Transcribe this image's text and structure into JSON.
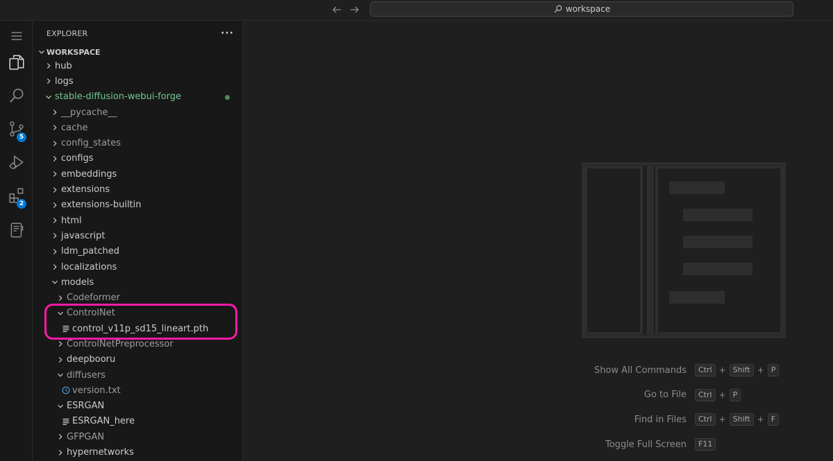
{
  "titlebar": {
    "back_label": "←",
    "forward_label": "→",
    "command_center": "workspace",
    "icons": {
      "back": "arrow-left-icon",
      "forward": "arrow-right-icon",
      "search": "search-icon"
    }
  },
  "activity_bar": {
    "items": [
      {
        "name": "menu",
        "icon": "hamburger-menu-icon"
      },
      {
        "name": "explorer",
        "icon": "files-icon",
        "active": true
      },
      {
        "name": "search",
        "icon": "search-icon"
      },
      {
        "name": "source-control",
        "icon": "source-control-icon",
        "badge": "5"
      },
      {
        "name": "run-debug",
        "icon": "run-debug-icon"
      },
      {
        "name": "extensions",
        "icon": "extensions-icon",
        "badge": "2"
      },
      {
        "name": "notebook",
        "icon": "notebook-icon"
      }
    ]
  },
  "sidebar": {
    "title": "EXPLORER",
    "more_label": "···",
    "workspace_label": "WORKSPACE",
    "tree": [
      {
        "label": "hub",
        "depth": 0,
        "type": "folder",
        "expanded": false
      },
      {
        "label": "logs",
        "depth": 0,
        "type": "folder",
        "expanded": false
      },
      {
        "label": "stable-diffusion-webui-forge",
        "depth": 0,
        "type": "folder",
        "expanded": true,
        "git": true
      },
      {
        "label": "__pycache__",
        "depth": 1,
        "type": "folder",
        "expanded": false,
        "dim": true
      },
      {
        "label": "cache",
        "depth": 1,
        "type": "folder",
        "expanded": false,
        "dim": true
      },
      {
        "label": "config_states",
        "depth": 1,
        "type": "folder",
        "expanded": false,
        "dim": true
      },
      {
        "label": "configs",
        "depth": 1,
        "type": "folder",
        "expanded": false
      },
      {
        "label": "embeddings",
        "depth": 1,
        "type": "folder",
        "expanded": false
      },
      {
        "label": "extensions",
        "depth": 1,
        "type": "folder",
        "expanded": false
      },
      {
        "label": "extensions-builtin",
        "depth": 1,
        "type": "folder",
        "expanded": false
      },
      {
        "label": "html",
        "depth": 1,
        "type": "folder",
        "expanded": false
      },
      {
        "label": "javascript",
        "depth": 1,
        "type": "folder",
        "expanded": false
      },
      {
        "label": "ldm_patched",
        "depth": 1,
        "type": "folder",
        "expanded": false
      },
      {
        "label": "localizations",
        "depth": 1,
        "type": "folder",
        "expanded": false
      },
      {
        "label": "models",
        "depth": 1,
        "type": "folder",
        "expanded": true
      },
      {
        "label": "Codeformer",
        "depth": 2,
        "type": "folder",
        "expanded": false,
        "dim": true
      },
      {
        "label": "ControlNet",
        "depth": 2,
        "type": "folder",
        "expanded": true,
        "dim": true
      },
      {
        "label": "control_v11p_sd15_lineart.pth",
        "depth": 3,
        "type": "file",
        "icon": "lines-file-icon"
      },
      {
        "label": "ControlNetPreprocessor",
        "depth": 2,
        "type": "folder",
        "expanded": false,
        "dim": true
      },
      {
        "label": "deepbooru",
        "depth": 2,
        "type": "folder",
        "expanded": false
      },
      {
        "label": "diffusers",
        "depth": 2,
        "type": "folder",
        "expanded": true,
        "dim": true
      },
      {
        "label": "version.txt",
        "depth": 3,
        "type": "file",
        "icon": "clock-file-icon",
        "dim": true
      },
      {
        "label": "ESRGAN",
        "depth": 2,
        "type": "folder",
        "expanded": true
      },
      {
        "label": "ESRGAN_here",
        "depth": 3,
        "type": "file",
        "icon": "lines-file-icon"
      },
      {
        "label": "GFPGAN",
        "depth": 2,
        "type": "folder",
        "expanded": false,
        "dim": true
      },
      {
        "label": "hypernetworks",
        "depth": 2,
        "type": "folder",
        "expanded": false
      }
    ]
  },
  "editor": {
    "watermark_icon": "vscode-layout-watermark-icon",
    "shortcuts": [
      {
        "label": "Show All Commands",
        "keys": [
          "Ctrl",
          "Shift",
          "P"
        ]
      },
      {
        "label": "Go to File",
        "keys": [
          "Ctrl",
          "P"
        ]
      },
      {
        "label": "Find in Files",
        "keys": [
          "Ctrl",
          "Shift",
          "F"
        ]
      },
      {
        "label": "Toggle Full Screen",
        "keys": [
          "F11"
        ]
      }
    ]
  },
  "colors": {
    "accent": "#0078d4",
    "highlight": "#ff1aa8",
    "git_modified": "#73c991"
  }
}
